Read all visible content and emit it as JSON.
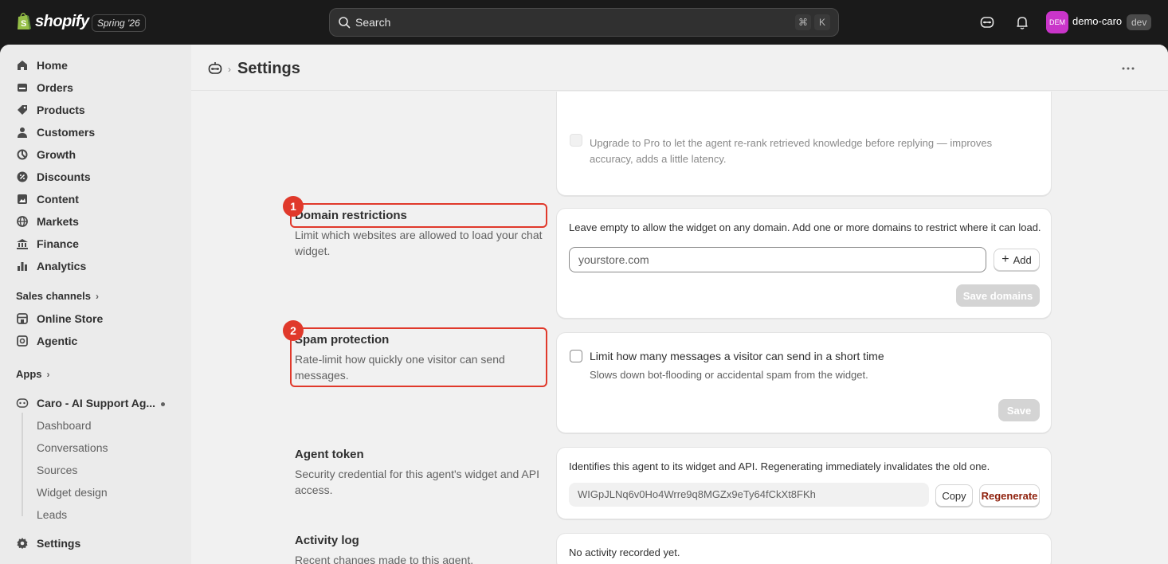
{
  "topbar": {
    "logo_text": "shopify",
    "edition": "Spring '26",
    "search_placeholder": "Search",
    "shortcut_key1": "⌘",
    "shortcut_key2": "K",
    "avatar_initials": "DEM",
    "store_name": "demo-caro",
    "env_badge": "dev"
  },
  "sidebar": {
    "items": [
      {
        "label": "Home",
        "icon": "home-icon"
      },
      {
        "label": "Orders",
        "icon": "orders-icon"
      },
      {
        "label": "Products",
        "icon": "tag-icon"
      },
      {
        "label": "Customers",
        "icon": "person-icon"
      },
      {
        "label": "Growth",
        "icon": "growth-icon"
      },
      {
        "label": "Discounts",
        "icon": "discount-icon"
      },
      {
        "label": "Content",
        "icon": "content-icon"
      },
      {
        "label": "Markets",
        "icon": "globe-icon"
      },
      {
        "label": "Finance",
        "icon": "bank-icon"
      },
      {
        "label": "Analytics",
        "icon": "bar-chart-icon"
      }
    ],
    "sales_channels_label": "Sales channels",
    "channels": [
      {
        "label": "Online Store",
        "icon": "store-icon"
      },
      {
        "label": "Agentic",
        "icon": "agentic-icon"
      }
    ],
    "apps_label": "Apps",
    "app_name": "Caro - AI Support Ag...",
    "app_subitems": [
      "Dashboard",
      "Conversations",
      "Sources",
      "Widget design",
      "Leads"
    ],
    "settings_label": "Settings"
  },
  "header": {
    "title": "Settings"
  },
  "rerank": {
    "description": "Upgrade to Pro to let the agent re-rank retrieved knowledge before replying — improves accuracy, adds a little latency."
  },
  "domain": {
    "marker": "1",
    "title": "Domain restrictions",
    "description": "Limit which websites are allowed to load your chat widget.",
    "help": "Leave empty to allow the widget on any domain. Add one or more domains to restrict where it can load.",
    "input_placeholder": "yourstore.com",
    "add_label": "Add",
    "save_label": "Save domains"
  },
  "spam": {
    "marker": "2",
    "title": "Spam protection",
    "description": "Rate-limit how quickly one visitor can send messages.",
    "checkbox_label": "Limit how many messages a visitor can send in a short time",
    "checkbox_help": "Slows down bot-flooding or accidental spam from the widget.",
    "save_label": "Save"
  },
  "token": {
    "title": "Agent token",
    "description": "Security credential for this agent's widget and API access.",
    "help": "Identifies this agent to its widget and API. Regenerating immediately invalidates the old one.",
    "value": "WIGpJLNq6v0Ho4Wrre9q8MGZx9eTy64fCkXt8FKh",
    "copy_label": "Copy",
    "regenerate_label": "Regenerate"
  },
  "activity": {
    "title": "Activity log",
    "description": "Recent changes made to this agent.",
    "empty": "No activity recorded yet."
  },
  "colors": {
    "highlight": "#e0392b",
    "regenerate": "#8e1f0b",
    "avatar": "#c935c9"
  }
}
